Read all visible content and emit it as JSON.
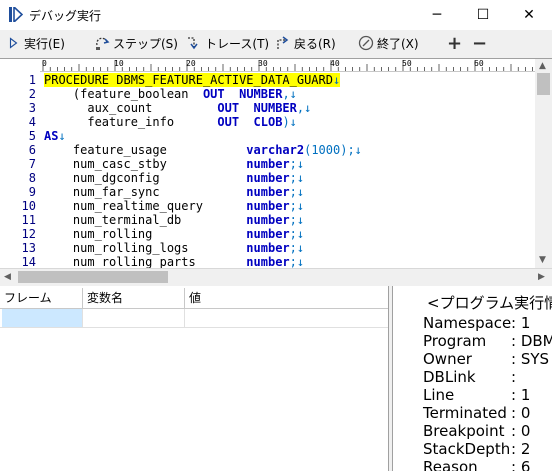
{
  "window": {
    "title": "デバッグ実行",
    "minimize": "─",
    "maximize": "☐",
    "close": "✕"
  },
  "toolbar": {
    "run": "実行(E)",
    "step": "ステップ(S)",
    "trace": "トレース(T)",
    "return": "戻る(R)",
    "exit": "終了(X)",
    "plus": "+",
    "minus": "−"
  },
  "ruler": {
    "marks": [
      "0",
      "10",
      "20",
      "30",
      "40",
      "50",
      "60"
    ]
  },
  "code": {
    "lines": [
      {
        "n": "1",
        "segments": [
          {
            "t": "PROCEDURE DBMS_FEATURE_ACTIVE_DATA_GUARD",
            "c": "hl"
          },
          {
            "t": "↓",
            "c": "hl cm"
          }
        ]
      },
      {
        "n": "2",
        "segments": [
          {
            "t": "    (feature_boolean  "
          },
          {
            "t": "OUT",
            "c": "kw"
          },
          {
            "t": "  "
          },
          {
            "t": "NUMBER",
            "c": "kw"
          },
          {
            "t": ",↓",
            "c": "cm"
          }
        ]
      },
      {
        "n": "3",
        "segments": [
          {
            "t": "      aux_count         "
          },
          {
            "t": "OUT",
            "c": "kw"
          },
          {
            "t": "  "
          },
          {
            "t": "NUMBER",
            "c": "kw"
          },
          {
            "t": ",↓",
            "c": "cm"
          }
        ]
      },
      {
        "n": "4",
        "segments": [
          {
            "t": "      feature_info      "
          },
          {
            "t": "OUT",
            "c": "kw"
          },
          {
            "t": "  "
          },
          {
            "t": "CLOB",
            "c": "kw"
          },
          {
            "t": ")↓",
            "c": "cm"
          }
        ]
      },
      {
        "n": "5",
        "segments": [
          {
            "t": "AS",
            "c": "kw"
          },
          {
            "t": "↓",
            "c": "cm"
          }
        ]
      },
      {
        "n": "6",
        "segments": [
          {
            "t": "    feature_usage           "
          },
          {
            "t": "varchar2",
            "c": "kw"
          },
          {
            "t": "(1000);↓",
            "c": "cm"
          }
        ]
      },
      {
        "n": "7",
        "segments": [
          {
            "t": "    num_casc_stby           "
          },
          {
            "t": "number",
            "c": "kw"
          },
          {
            "t": ";↓",
            "c": "cm"
          }
        ]
      },
      {
        "n": "8",
        "segments": [
          {
            "t": "    num_dgconfig            "
          },
          {
            "t": "number",
            "c": "kw"
          },
          {
            "t": ";↓",
            "c": "cm"
          }
        ]
      },
      {
        "n": "9",
        "segments": [
          {
            "t": "    num_far_sync            "
          },
          {
            "t": "number",
            "c": "kw"
          },
          {
            "t": ";↓",
            "c": "cm"
          }
        ]
      },
      {
        "n": "10",
        "segments": [
          {
            "t": "    num_realtime_query      "
          },
          {
            "t": "number",
            "c": "kw"
          },
          {
            "t": ";↓",
            "c": "cm"
          }
        ]
      },
      {
        "n": "11",
        "segments": [
          {
            "t": "    num_terminal_db         "
          },
          {
            "t": "number",
            "c": "kw"
          },
          {
            "t": ";↓",
            "c": "cm"
          }
        ]
      },
      {
        "n": "12",
        "segments": [
          {
            "t": "    num_rolling             "
          },
          {
            "t": "number",
            "c": "kw"
          },
          {
            "t": ";↓",
            "c": "cm"
          }
        ]
      },
      {
        "n": "13",
        "segments": [
          {
            "t": "    num_rolling_logs        "
          },
          {
            "t": "number",
            "c": "kw"
          },
          {
            "t": ";↓",
            "c": "cm"
          }
        ]
      },
      {
        "n": "14",
        "segments": [
          {
            "t": "    num_rolling_parts       "
          },
          {
            "t": "number",
            "c": "kw"
          },
          {
            "t": ";↓",
            "c": "cm"
          }
        ]
      }
    ]
  },
  "variables": {
    "headers": {
      "frame": "フレーム",
      "name": "変数名",
      "value": "値"
    }
  },
  "info": {
    "title": "<プログラム実行情報>",
    "rows": [
      {
        "k": "Namespace",
        "v": ": 1"
      },
      {
        "k": "Program",
        "v": ": DBMS_FEATURE_ACTIVE_DATA_GUARD"
      },
      {
        "k": "Owner",
        "v": ": SYS"
      },
      {
        "k": "DBLink",
        "v": ":"
      },
      {
        "k": "Line",
        "v": ": 1"
      },
      {
        "k": "Terminated",
        "v": ": 0"
      },
      {
        "k": "Breakpoint",
        "v": ": 0"
      },
      {
        "k": "StackDepth",
        "v": ": 2"
      },
      {
        "k": "Reason",
        "v": ": 6"
      }
    ]
  },
  "colors": {
    "highlight": "#ffff00",
    "keyword": "#0000c0",
    "selected_cell": "#cce8ff"
  }
}
